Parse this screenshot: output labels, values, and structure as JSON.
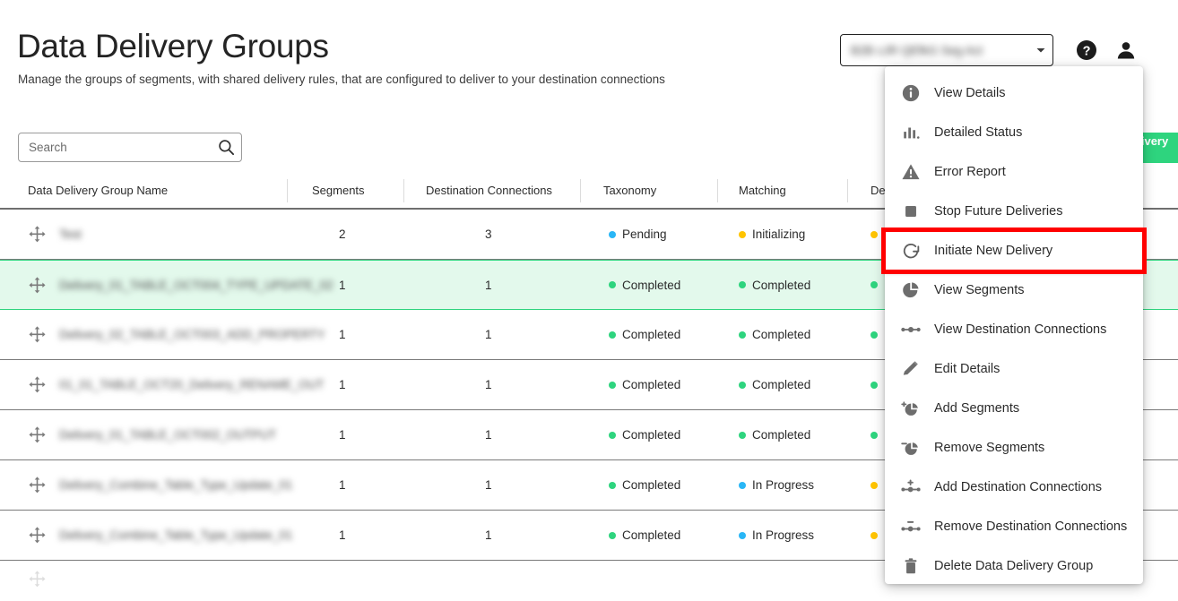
{
  "header": {
    "title": "Data Delivery Groups",
    "subtitle": "Manage the groups of segments, with shared delivery rules, that are configured to deliver to your destination connections",
    "account_select_value": "B2B cJR QEfkG Seg Act",
    "help_icon": "help-circle-icon",
    "avatar_icon": "user-avatar-icon"
  },
  "toolbar": {
    "search_placeholder": "Search",
    "search_value": "",
    "search_icon": "search-icon",
    "create_label": "Create Data Delivery Group"
  },
  "table": {
    "columns": [
      "Data Delivery Group Name",
      "Segments",
      "Destination Connections",
      "Taxonomy",
      "Matching",
      "Delivery"
    ],
    "rows": [
      {
        "drag_icon": "move-icon",
        "name": "Test",
        "segments": "2",
        "destination_connections": "3",
        "taxonomy": "Pending",
        "taxonomy_color": "#29B6F6",
        "matching": "Initializing",
        "matching_color": "#FFC400",
        "delivery_color": "#FFC400",
        "selected": false
      },
      {
        "drag_icon": "move-icon",
        "name": "Delivery_01_TABLE_OCT004_TYPE_UPDATE_02",
        "segments": "1",
        "destination_connections": "1",
        "taxonomy": "Completed",
        "taxonomy_color": "#2ED47E",
        "matching": "Completed",
        "matching_color": "#2ED47E",
        "delivery_color": "#2ED47E",
        "selected": true
      },
      {
        "drag_icon": "move-icon",
        "name": "Delivery_02_TABLE_OCT003_ADD_PROPERTY",
        "segments": "1",
        "destination_connections": "1",
        "taxonomy": "Completed",
        "taxonomy_color": "#2ED47E",
        "matching": "Completed",
        "matching_color": "#2ED47E",
        "delivery_color": "#2ED47E",
        "selected": false
      },
      {
        "drag_icon": "move-icon",
        "name": "01_01_TABLE_OCT20_Delivery_RENAME_OUT",
        "segments": "1",
        "destination_connections": "1",
        "taxonomy": "Completed",
        "taxonomy_color": "#2ED47E",
        "matching": "Completed",
        "matching_color": "#2ED47E",
        "delivery_color": "#2ED47E",
        "selected": false
      },
      {
        "drag_icon": "move-icon",
        "name": "Delivery_01_TABLE_OCT002_OUTPUT",
        "segments": "1",
        "destination_connections": "1",
        "taxonomy": "Completed",
        "taxonomy_color": "#2ED47E",
        "matching": "Completed",
        "matching_color": "#2ED47E",
        "delivery_color": "#2ED47E",
        "selected": false
      },
      {
        "drag_icon": "move-icon",
        "name": "Delivery_Combine_Table_Type_Update_01",
        "segments": "1",
        "destination_connections": "1",
        "taxonomy": "Completed",
        "taxonomy_color": "#2ED47E",
        "matching": "In Progress",
        "matching_color": "#29B6F6",
        "delivery_color": "#FFC400",
        "selected": false
      },
      {
        "drag_icon": "move-icon",
        "name": "Delivery_Combine_Table_Type_Update_01",
        "segments": "1",
        "destination_connections": "1",
        "taxonomy": "Completed",
        "taxonomy_color": "#2ED47E",
        "matching": "In Progress",
        "matching_color": "#29B6F6",
        "delivery_color": "#FFC400",
        "selected": false
      }
    ]
  },
  "action_menu": {
    "items": [
      {
        "label": "View Details",
        "icon": "info-icon"
      },
      {
        "label": "Detailed Status",
        "icon": "bar-chart-icon"
      },
      {
        "label": "Error Report",
        "icon": "warning-triangle-icon"
      },
      {
        "label": "Stop Future Deliveries",
        "icon": "stop-square-icon"
      },
      {
        "label": "Initiate New Delivery",
        "icon": "refresh-icon",
        "highlighted": true
      },
      {
        "label": "View Segments",
        "icon": "pie-chart-icon"
      },
      {
        "label": "View Destination Connections",
        "icon": "connections-icon"
      },
      {
        "label": "Edit Details",
        "icon": "pencil-icon"
      },
      {
        "label": "Add Segments",
        "icon": "pie-chart-plus-icon"
      },
      {
        "label": "Remove Segments",
        "icon": "pie-chart-minus-icon"
      },
      {
        "label": "Add Destination Connections",
        "icon": "connections-plus-icon"
      },
      {
        "label": "Remove Destination Connections",
        "icon": "connections-minus-icon"
      },
      {
        "label": "Delete Data Delivery Group",
        "icon": "trash-icon"
      }
    ]
  },
  "colors": {
    "accent_green": "#2ED47E",
    "status_blue": "#29B6F6",
    "status_yellow": "#FFC400",
    "highlight_red": "#FF0000",
    "selected_row_bg": "#E3F9EC"
  }
}
